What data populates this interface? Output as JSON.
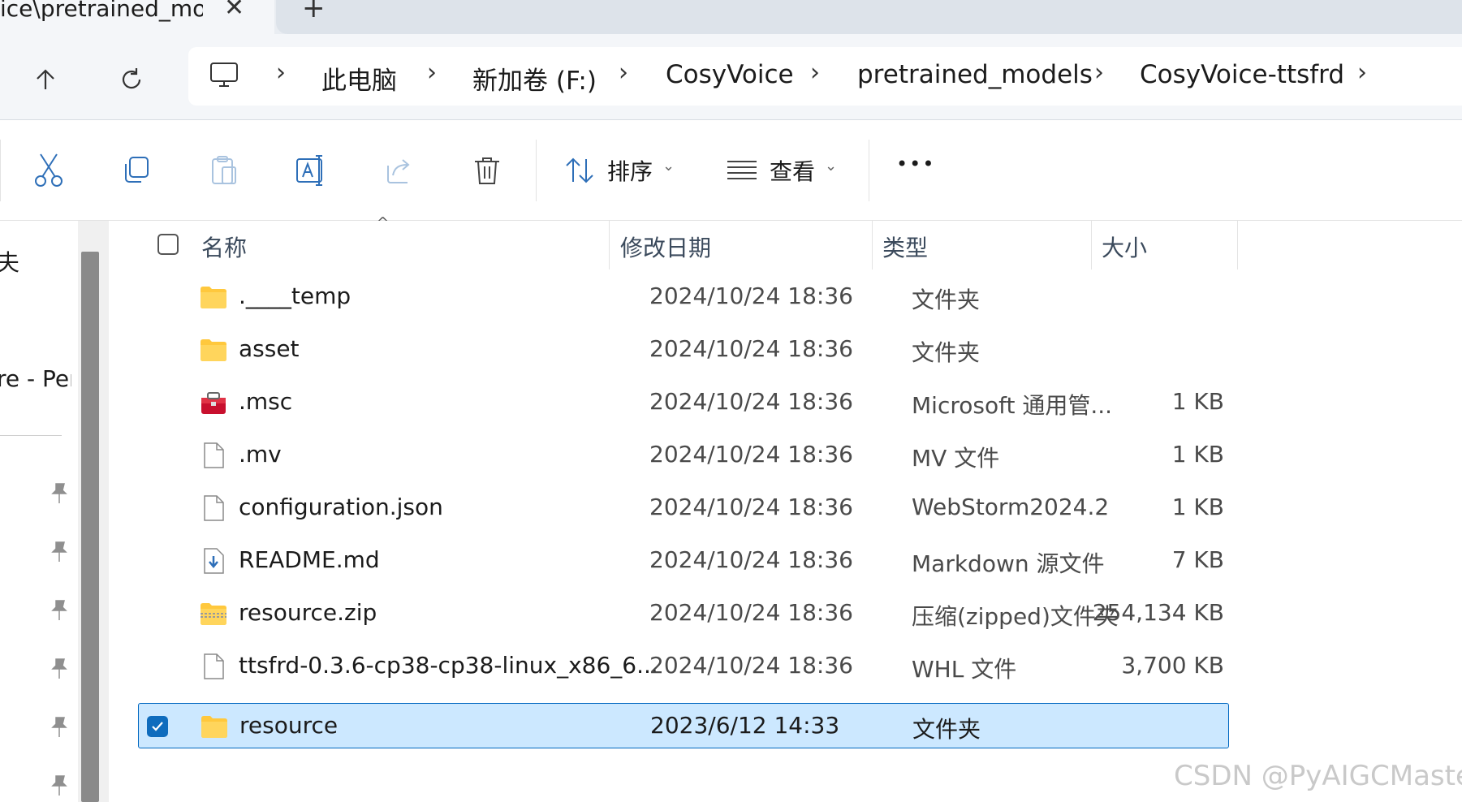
{
  "tab": {
    "title": "ice\\pretrained_mode",
    "close": "✕",
    "new": "+"
  },
  "nav": {
    "breadcrumbs": [
      "此电脑",
      "新加卷 (F:)",
      "CosyVoice",
      "pretrained_models",
      "CosyVoice-ttsfrd"
    ],
    "separator": "›"
  },
  "toolbar": {
    "sort_label": "排序",
    "view_label": "查看",
    "more_label": "•••"
  },
  "sidebar": {
    "fragment_top": "夫",
    "fragment_mid": "re - Pers"
  },
  "columns": {
    "name": "名称",
    "date": "修改日期",
    "type": "类型",
    "size": "大小"
  },
  "files": [
    {
      "name": ".____temp",
      "date": "2024/10/24 18:36",
      "type": "文件夹",
      "size": "",
      "icon": "folder-icon"
    },
    {
      "name": "asset",
      "date": "2024/10/24 18:36",
      "type": "文件夹",
      "size": "",
      "icon": "folder-icon"
    },
    {
      "name": ".msc",
      "date": "2024/10/24 18:36",
      "type": "Microsoft 通用管...",
      "size": "1 KB",
      "icon": "toolbox-icon"
    },
    {
      "name": ".mv",
      "date": "2024/10/24 18:36",
      "type": "MV 文件",
      "size": "1 KB",
      "icon": "file-icon"
    },
    {
      "name": "configuration.json",
      "date": "2024/10/24 18:36",
      "type": "WebStorm2024.2",
      "size": "1 KB",
      "icon": "file-icon"
    },
    {
      "name": "README.md",
      "date": "2024/10/24 18:36",
      "type": "Markdown 源文件",
      "size": "7 KB",
      "icon": "markdown-file-icon"
    },
    {
      "name": "resource.zip",
      "date": "2024/10/24 18:36",
      "type": "压缩(zipped)文件夹",
      "size": "254,134 KB",
      "icon": "zip-folder-icon"
    },
    {
      "name": "ttsfrd-0.3.6-cp38-cp38-linux_x86_6...",
      "date": "2024/10/24 18:36",
      "type": "WHL 文件",
      "size": "3,700 KB",
      "icon": "file-icon"
    },
    {
      "name": "resource",
      "date": "2023/6/12 14:33",
      "type": "文件夹",
      "size": "",
      "icon": "folder-icon",
      "selected": true
    }
  ],
  "watermark": "CSDN @PyAIGCMaster",
  "colors": {
    "selection": "#cce8ff",
    "accent": "#0f6cbd",
    "folder": "#ffc83d"
  }
}
